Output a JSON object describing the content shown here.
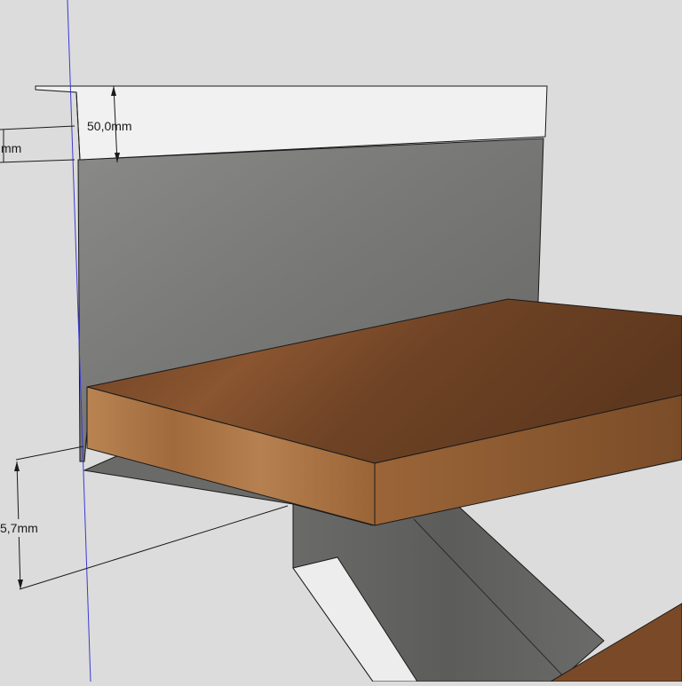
{
  "viewport": {
    "background": "#dcdcdc",
    "axis_color": "#3b3bd6"
  },
  "materials": {
    "concrete": "#7e7e7c",
    "wood_top": "#7a4a28",
    "wood_edge": "#b07a48",
    "cap": "#f1f1f1"
  },
  "dimensions": {
    "top_height": "50,0mm",
    "left_upper": "mm",
    "left_lower": "5,7mm"
  }
}
